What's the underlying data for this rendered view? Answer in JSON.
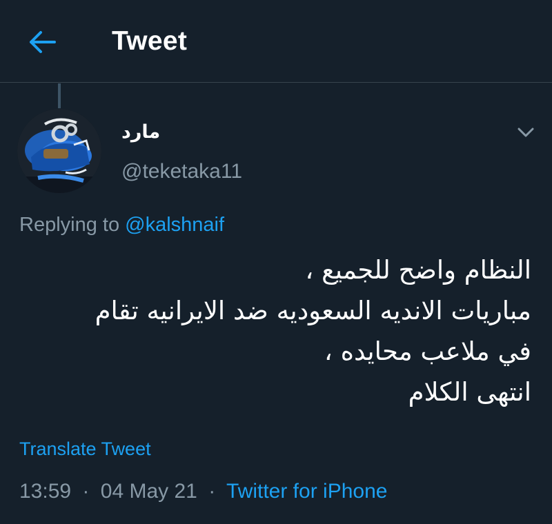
{
  "header": {
    "back_icon": "arrow-left-icon",
    "title": "Tweet"
  },
  "tweet": {
    "author": {
      "display_name": "مارد",
      "handle": "@teketaka11",
      "avatar_icon": "avatar-image"
    },
    "menu_icon": "chevron-down-icon",
    "replying_to": {
      "prefix": "Replying to",
      "mention": "@kalshnaif"
    },
    "text_lines": [
      "النظام واضح للجميع ،",
      "مباريات الانديه السعوديه ضد الايرانيه تقام",
      "في ملاعب محايده ،",
      "انتهى الكلام"
    ],
    "translate_label": "Translate Tweet",
    "time": "13:59",
    "date": "04 May 21",
    "separator": "·",
    "source": "Twitter for iPhone"
  },
  "colors": {
    "background": "#15202b",
    "accent": "#1da1f2",
    "secondary_text": "#8899a6",
    "divider": "#38444d"
  }
}
